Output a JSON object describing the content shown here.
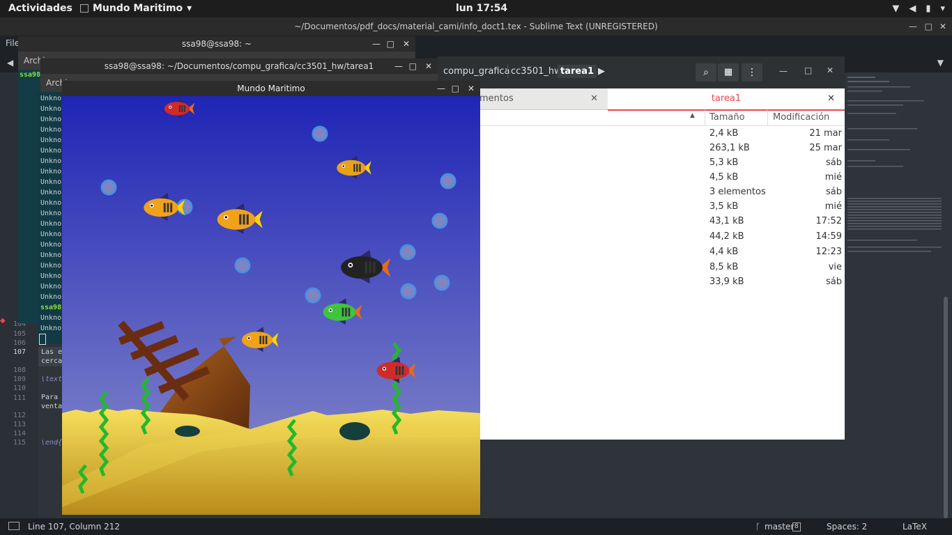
{
  "topbar": {
    "activities": "Actividades",
    "app_name": "Mundo Maritimo",
    "clock": "lun 17:54"
  },
  "sublime": {
    "title": "~/Documentos/pdf_docs/material_cami/info_doct1.tex - Sublime Text (UNREGISTERED)",
    "menu_first": "File",
    "gutter": [
      "104",
      "105",
      "106",
      "107",
      "108",
      "109",
      "110",
      "111",
      "112",
      "113",
      "114",
      "115"
    ],
    "code_lines": {
      "l107a": "Las e",
      "l107b": "cerca",
      "l109": "\\text",
      "l111a": "Para",
      "l111b": "venta",
      "l115": "\\end{"
    },
    "status": {
      "position": "Line 107, Column 212",
      "branch": "master",
      "branch_count": "8",
      "spaces": "Spaces: 2",
      "syntax": "LaTeX"
    }
  },
  "terminal_back": {
    "title": "ssa98@ssa98: ~",
    "menu": "Archi",
    "prompt": "ssa98",
    "line_prefix": "Unkno"
  },
  "terminal_front": {
    "title": "ssa98@ssa98: ~/Documentos/compu_grafica/cc3501_hw/tarea1",
    "menu": "Archi"
  },
  "files": {
    "breadcrumbs": [
      "compu_grafica",
      "cc3501_hw",
      "tarea1"
    ],
    "tab_other": "mentos",
    "tab_active": "tarea1",
    "col_size": "Tamaño",
    "col_mod": "Modificación",
    "rows": [
      {
        "size": "2,4 kB",
        "mod": "21 mar"
      },
      {
        "size": "263,1 kB",
        "mod": "25 mar"
      },
      {
        "size": "5,3 kB",
        "mod": "sáb"
      },
      {
        "size": "4,5 kB",
        "mod": "mié"
      },
      {
        "size": "3 elementos",
        "mod": "sáb"
      },
      {
        "size": "3,5 kB",
        "mod": "mié"
      },
      {
        "size": "43,1 kB",
        "mod": "17:52"
      },
      {
        "size": "44,2 kB",
        "mod": "14:59"
      },
      {
        "size": "4,4 kB",
        "mod": "12:23"
      },
      {
        "size": "8,5 kB",
        "mod": "vie"
      },
      {
        "size": "33,9 kB",
        "mod": "sáb"
      }
    ]
  },
  "game": {
    "title": "Mundo Maritimo"
  },
  "colors": {
    "water_top": "#1f25b5",
    "water_bottom": "#8c90cc",
    "sand": "#f1d54d",
    "active_tab": "#e8474f"
  }
}
